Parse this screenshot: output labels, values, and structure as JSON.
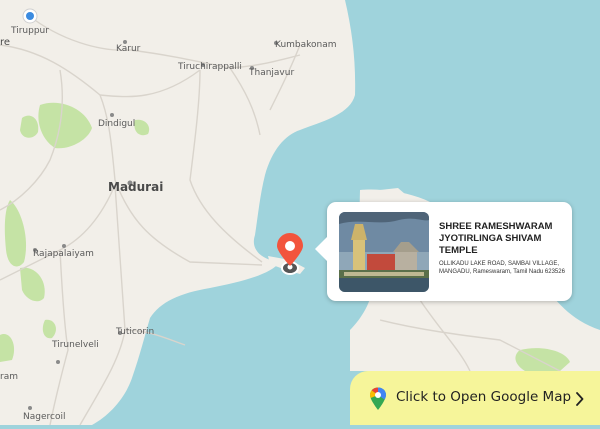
{
  "map": {
    "cities": [
      {
        "id": "tiruppur",
        "label": "Tiruppur",
        "big": false
      },
      {
        "id": "karur",
        "label": "Karur",
        "big": false
      },
      {
        "id": "kumbakonam",
        "label": "Kumbakonam",
        "big": false
      },
      {
        "id": "tiruchirappalli",
        "label": "Tiruchirappalli",
        "big": false
      },
      {
        "id": "thanjavur",
        "label": "Thanjavur",
        "big": false
      },
      {
        "id": "dindigul",
        "label": "Dindigul",
        "big": false
      },
      {
        "id": "madurai",
        "label": "Madurai",
        "big": true
      },
      {
        "id": "rajapalaiyam",
        "label": "Rajapalaiyam",
        "big": false
      },
      {
        "id": "tuticorin",
        "label": "Tuticorin",
        "big": false
      },
      {
        "id": "tirunelveli",
        "label": "Tirunelveli",
        "big": false
      },
      {
        "id": "nagercoil",
        "label": "Nagercoil",
        "big": false
      },
      {
        "id": "edge-top",
        "label": "re",
        "big": false
      },
      {
        "id": "edge-bottom",
        "label": "ram",
        "big": false
      }
    ],
    "colors": {
      "sea": "#9fd3dc",
      "land": "#f2efe9",
      "park": "#c5e3a5",
      "road": "#d9d4cc",
      "pin": "#f2543d"
    }
  },
  "popup": {
    "title": "SHREE RAMESHWARAM JYOTIRLINGA SHIVAM TEMPLE",
    "address": "OLLIKADU LAKE ROAD, SAMBAI VILLAGE, MANGADU, Rameswaram, Tamil Nadu 623526",
    "image_icon": "temple-photo"
  },
  "cta": {
    "label": "Click to Open Google Map",
    "icon": "google-maps-pin-icon",
    "chevron": "chevron-right-icon",
    "color": "#f6f59a"
  }
}
